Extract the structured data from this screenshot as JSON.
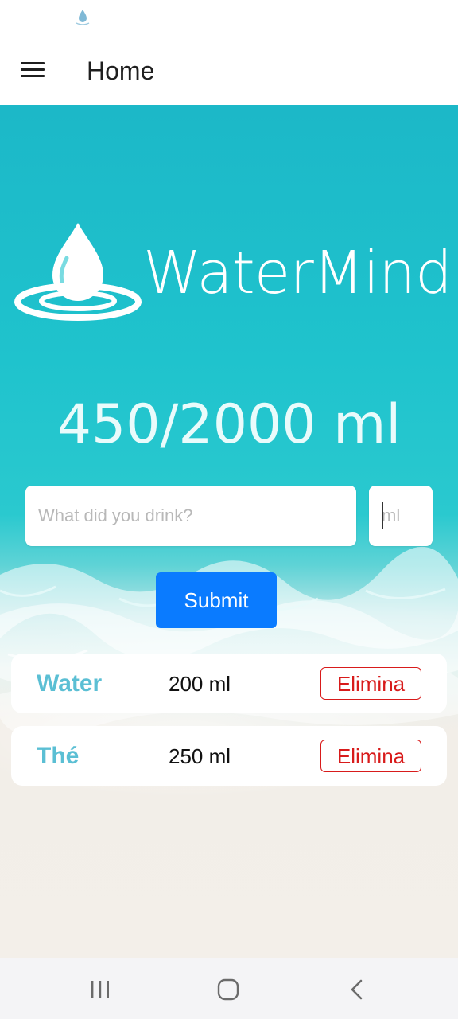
{
  "app": {
    "title": "Home",
    "brand_name": "WaterMind"
  },
  "progress": {
    "text": "450/2000 ml",
    "consumed_ml": 450,
    "goal_ml": 2000
  },
  "form": {
    "drink_placeholder": "What did you drink?",
    "drink_value": "",
    "amount_placeholder": "ml",
    "amount_value": "",
    "submit_label": "Submit"
  },
  "entries": [
    {
      "name": "Water",
      "amount": "200 ml",
      "delete_label": "Elimina"
    },
    {
      "name": "Thé",
      "amount": "250 ml",
      "delete_label": "Elimina"
    }
  ],
  "icons": {
    "status": "water-drop-icon",
    "menu": "hamburger-menu-icon",
    "logo": "water-drop-ripple-logo",
    "nav_recents": "recents-icon",
    "nav_home": "home-icon",
    "nav_back": "back-icon"
  },
  "colors": {
    "accent": "#0a7bff",
    "drink_name": "#5bbfd4",
    "delete": "#d81b1b",
    "sea": "#1fc3cd"
  }
}
